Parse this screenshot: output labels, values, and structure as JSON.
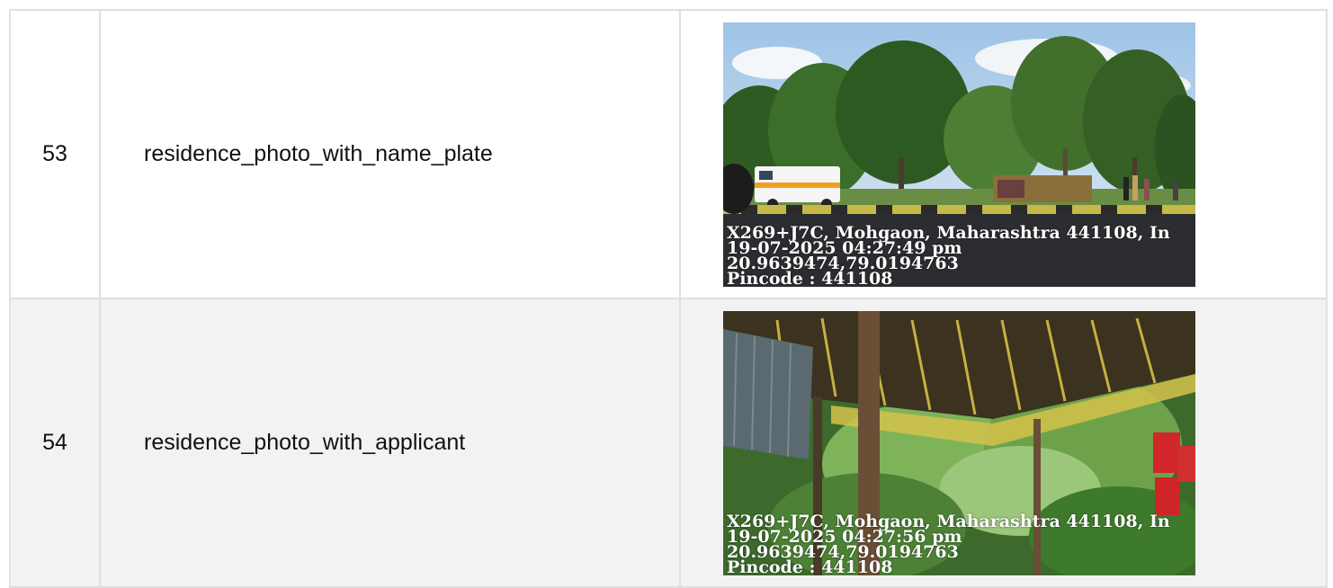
{
  "rows": [
    {
      "index": "53",
      "field": "residence_photo_with_name_plate",
      "photo": {
        "address": "X269+J7C, Mohgaon, Maharashtra 441108, In",
        "datetime": "19-07-2025 04:27:49 pm",
        "coords": "20.9639474,79.0194763",
        "pincode": "Pincode : 441108"
      }
    },
    {
      "index": "54",
      "field": "residence_photo_with_applicant",
      "photo": {
        "address": "X269+J7C, Mohgaon, Maharashtra 441108, In",
        "datetime": "19-07-2025 04:27:56 pm",
        "coords": "20.9639474,79.0194763",
        "pincode": "Pincode : 441108"
      }
    }
  ]
}
